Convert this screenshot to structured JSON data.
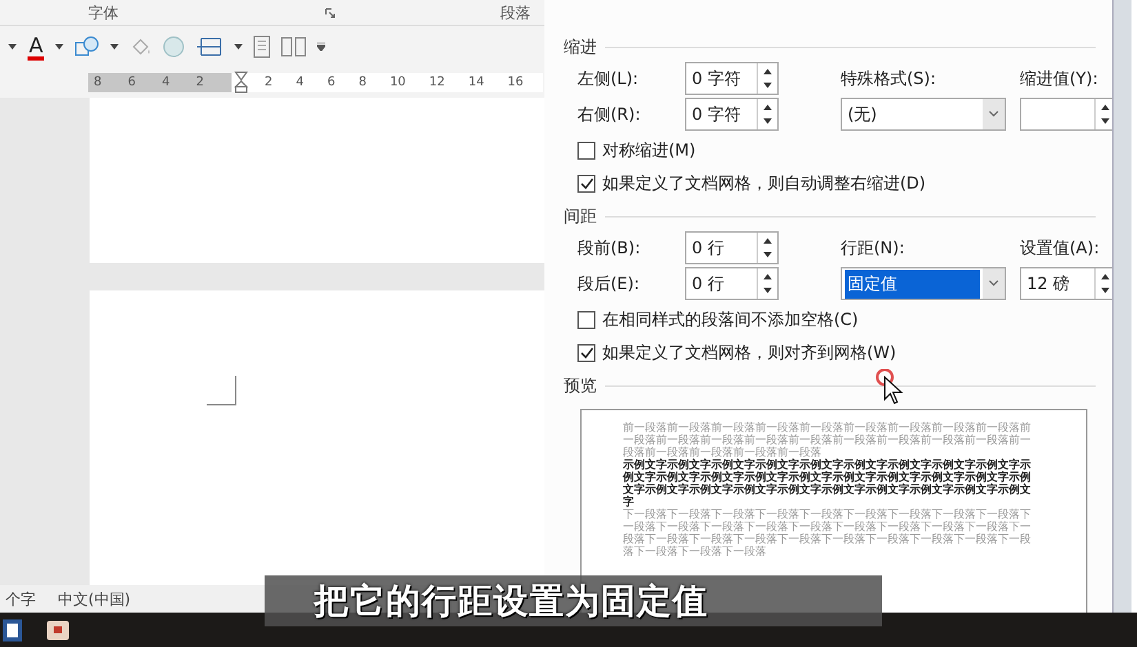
{
  "ribbon": {
    "groups": [
      {
        "label": "字体"
      },
      {
        "label": "段落"
      }
    ],
    "font_color_glyph": "A"
  },
  "ruler": {
    "left_ticks": [
      "8",
      "6",
      "4",
      "2"
    ],
    "right_ticks": [
      "2",
      "4",
      "6",
      "8",
      "10",
      "12",
      "14",
      "16"
    ]
  },
  "status_bar": {
    "word_count": "个字",
    "language": "中文(中国)"
  },
  "dialog": {
    "indent": {
      "title": "缩进",
      "left": {
        "label": "左侧(L):",
        "value": "0 字符"
      },
      "right": {
        "label": "右侧(R):",
        "value": "0 字符"
      },
      "special": {
        "label": "特殊格式(S):",
        "value": "(无)"
      },
      "by": {
        "label": "缩进值(Y):"
      },
      "checks": [
        {
          "label": "对称缩进(M)",
          "checked": false
        },
        {
          "label": "如果定义了文档网格，则自动调整右缩进(D)",
          "checked": true
        }
      ]
    },
    "spacing": {
      "title": "间距",
      "before": {
        "label": "段前(B):",
        "value": "0 行"
      },
      "after": {
        "label": "段后(E):",
        "value": "0 行"
      },
      "line": {
        "label": "行距(N):",
        "value": "固定值",
        "selected": true
      },
      "at": {
        "label": "设置值(A):",
        "value": "12 磅"
      },
      "checks": [
        {
          "label": "在相同样式的段落间不添加空格(C)",
          "checked": false
        },
        {
          "label": "如果定义了文档网格，则对齐到网格(W)",
          "checked": true
        }
      ]
    },
    "preview": {
      "title": "预览",
      "paragraphs": [
        {
          "kind": "previous",
          "text": "前一段落前一段落前一段落前一段落前一段落前一段落前一段落前一段落前一段落前一段落前一段落前一段落前一段落前一段落前一段落前一段落前一段落前一段落前一段落前一段落前一段落前一段落前一段落"
        },
        {
          "kind": "sample",
          "text": "示例文字示例文字示例文字示例文字示例文字示例文字示例文字示例文字示例文字示例文字示例文字示例文字示例文字示例文字示例文字示例文字示例文字示例文字示例文字示例文字示例文字示例文字示例文字示例文字示例文字示例文字示例文字示例文字"
        },
        {
          "kind": "next",
          "text": "下一段落下一段落下一段落下一段落下一段落下一段落下一段落下一段落下一段落下一段落下一段落下一段落下一段落下一段落下一段落下一段落下一段落下一段落下一段落下一段落下一段落下一段落下一段落下一段落下一段落下一段落下一段落下一段落下一段落下一段落下一段落"
        }
      ]
    }
  },
  "subtitle": "把它的行距设置为固定值"
}
